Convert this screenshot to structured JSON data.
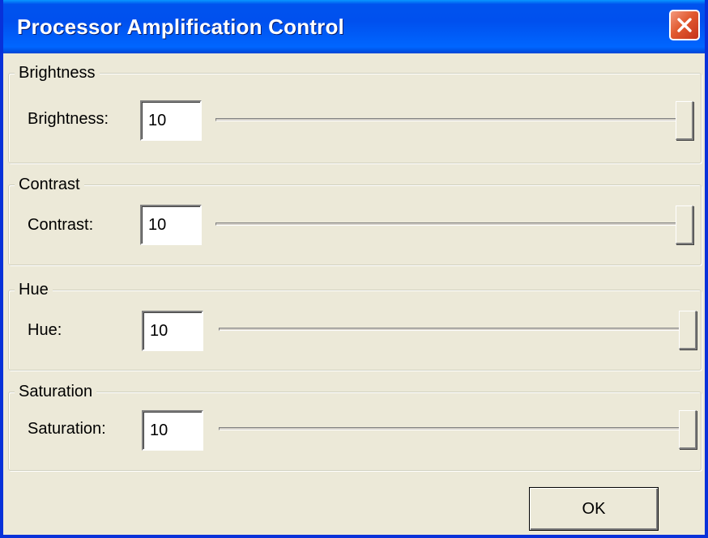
{
  "window": {
    "title": "Processor Amplification Control"
  },
  "groups": [
    {
      "legend": "Brightness",
      "label": "Brightness:",
      "value": "10",
      "slider_fraction": 1.0
    },
    {
      "legend": "Contrast",
      "label": "Contrast:",
      "value": "10",
      "slider_fraction": 1.0
    },
    {
      "legend": "Hue",
      "label": "Hue:",
      "value": "10",
      "slider_fraction": 1.0
    },
    {
      "legend": "Saturation",
      "label": "Saturation:",
      "value": "10",
      "slider_fraction": 1.0
    }
  ],
  "footer": {
    "ok_label": "OK"
  },
  "icons": {
    "close": "close-icon"
  },
  "colors": {
    "titlebar": "#0050EE",
    "close_button": "#E15A30",
    "dialog_background": "#ECE9D8"
  }
}
